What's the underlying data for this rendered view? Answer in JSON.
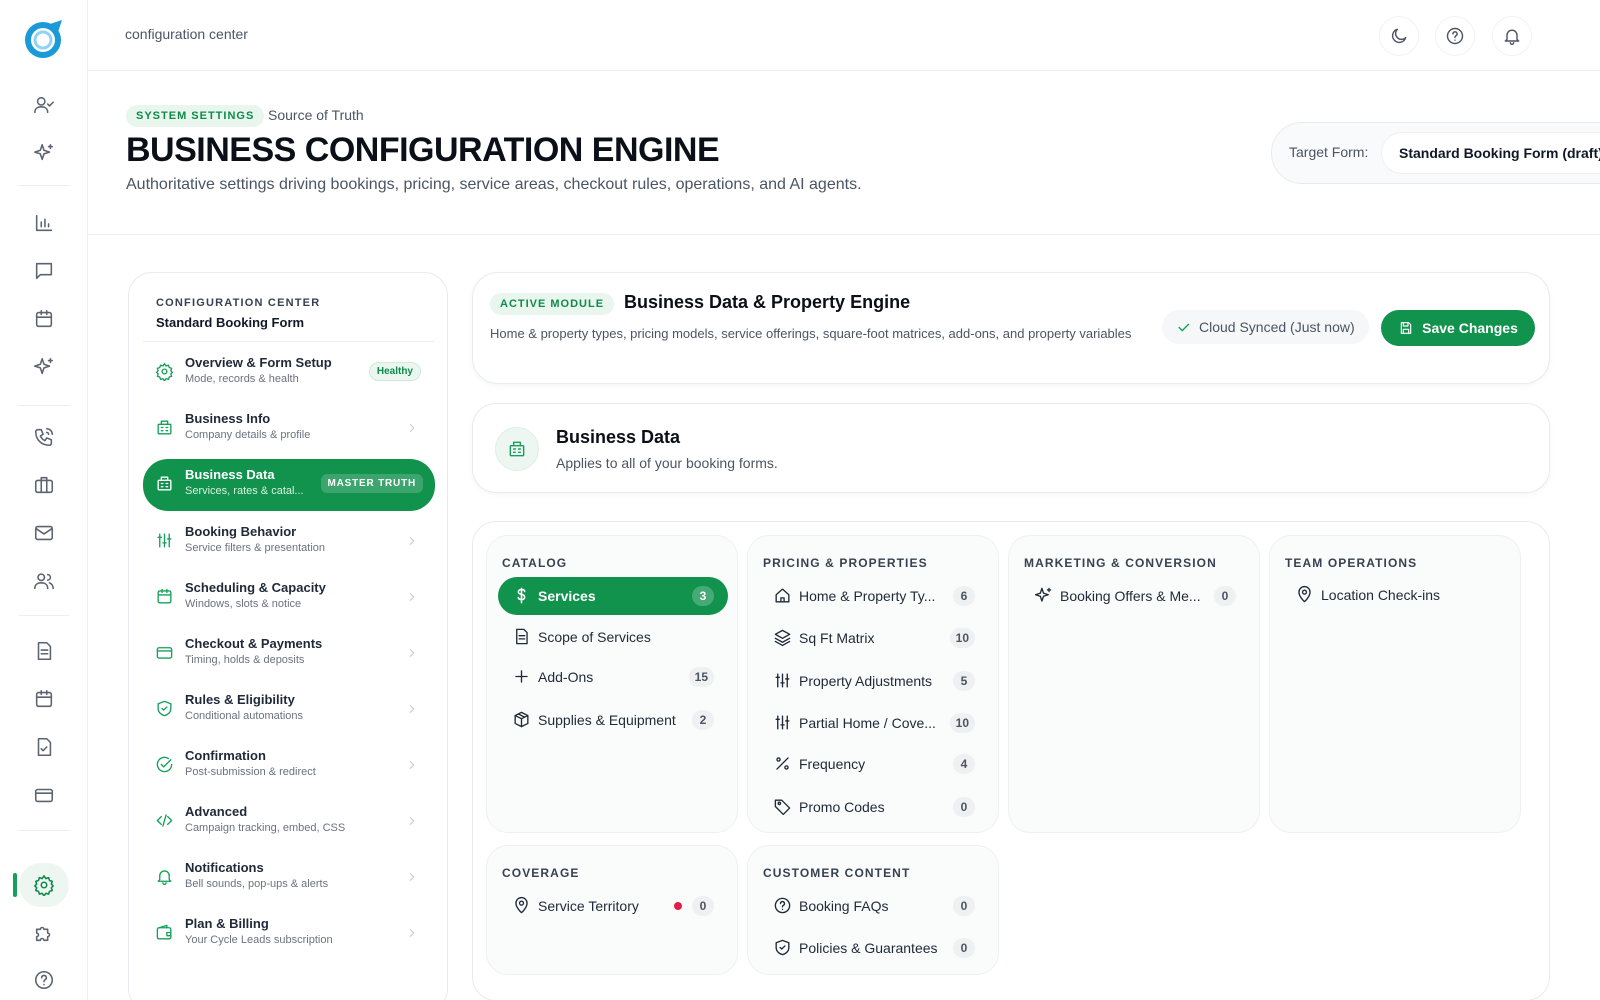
{
  "topbar": {
    "breadcrumb": "configuration center",
    "icons": [
      "moon-icon",
      "help-icon",
      "bell-icon"
    ]
  },
  "header": {
    "pill": "SYSTEM SETTINGS",
    "subtitle": "Source of Truth",
    "title": "BUSINESS CONFIGURATION ENGINE",
    "description": "Authoritative settings driving bookings, pricing, service areas, checkout rules, operations, and AI agents.",
    "target_label": "Target Form:",
    "target_value": "Standard Booking Form (draft)"
  },
  "sidebar": {
    "caption": "CONFIGURATION CENTER",
    "title": "Standard Booking Form",
    "items": [
      {
        "label": "Overview & Form Setup",
        "desc": "Mode, records & health",
        "badge": "Healthy",
        "icon": "gear-icon"
      },
      {
        "label": "Business Info",
        "desc": "Company details & profile",
        "icon": "building-icon"
      },
      {
        "label": "Business Data",
        "desc": "Services, rates & catal...",
        "badge": "MASTER TRUTH",
        "icon": "building-icon",
        "active": true
      },
      {
        "label": "Booking Behavior",
        "desc": "Service filters & presentation",
        "icon": "sliders-icon"
      },
      {
        "label": "Scheduling & Capacity",
        "desc": "Windows, slots & notice",
        "icon": "calendar-icon"
      },
      {
        "label": "Checkout & Payments",
        "desc": "Timing, holds & deposits",
        "icon": "credit-card-icon"
      },
      {
        "label": "Rules & Eligibility",
        "desc": "Conditional automations",
        "icon": "shield-check-icon"
      },
      {
        "label": "Confirmation",
        "desc": "Post-submission & redirect",
        "icon": "check-circle-icon"
      },
      {
        "label": "Advanced",
        "desc": "Campaign tracking, embed, CSS",
        "icon": "code-icon"
      },
      {
        "label": "Notifications",
        "desc": "Bell sounds, pop-ups & alerts",
        "icon": "bell-icon"
      },
      {
        "label": "Plan & Billing",
        "desc": "Your Cycle Leads subscription",
        "icon": "wallet-icon"
      }
    ]
  },
  "module": {
    "pill": "ACTIVE MODULE",
    "title": "Business Data & Property Engine",
    "description": "Home & property types, pricing models, service offerings, square-foot matrices, add-ons, and property variables",
    "sync_status": "Cloud Synced (Just now)",
    "save_label": "Save Changes"
  },
  "business_data": {
    "title": "Business Data",
    "subtitle": "Applies to all of your booking forms."
  },
  "groups": {
    "catalog": {
      "caption": "CATALOG",
      "items": [
        {
          "label": "Services",
          "count": "3",
          "icon": "dollar-icon",
          "active": true
        },
        {
          "label": "Scope of Services",
          "count": "",
          "icon": "document-icon"
        },
        {
          "label": "Add-Ons",
          "count": "15",
          "icon": "plus-icon"
        },
        {
          "label": "Supplies & Equipment",
          "count": "2",
          "icon": "package-icon"
        }
      ]
    },
    "pricing": {
      "caption": "PRICING & PROPERTIES",
      "items": [
        {
          "label": "Home & Property Ty...",
          "count": "6",
          "icon": "home-icon"
        },
        {
          "label": "Sq Ft Matrix",
          "count": "10",
          "icon": "layers-icon"
        },
        {
          "label": "Property Adjustments",
          "count": "5",
          "icon": "sliders-icon"
        },
        {
          "label": "Partial Home / Cove...",
          "count": "10",
          "icon": "sliders-icon"
        },
        {
          "label": "Frequency",
          "count": "4",
          "icon": "percent-icon"
        },
        {
          "label": "Promo Codes",
          "count": "0",
          "icon": "tag-icon"
        }
      ]
    },
    "marketing": {
      "caption": "MARKETING & CONVERSION",
      "items": [
        {
          "label": "Booking Offers & Me...",
          "count": "0",
          "icon": "sparkles-icon"
        }
      ]
    },
    "team": {
      "caption": "TEAM OPERATIONS",
      "items": [
        {
          "label": "Location Check-ins",
          "count": "",
          "icon": "map-pin-icon"
        }
      ]
    },
    "coverage": {
      "caption": "COVERAGE",
      "items": [
        {
          "label": "Service Territory",
          "count": "0",
          "icon": "map-pin-icon",
          "alert_color": "#e11d48"
        }
      ]
    },
    "content": {
      "caption": "CUSTOMER CONTENT",
      "items": [
        {
          "label": "Booking FAQs",
          "count": "0",
          "icon": "help-circle-icon"
        },
        {
          "label": "Policies & Guarantees",
          "count": "0",
          "icon": "shield-check-icon"
        }
      ]
    }
  },
  "colors": {
    "accent": "#11924d",
    "accent_soft": "#e8f6ee",
    "alert": "#e11d48"
  }
}
